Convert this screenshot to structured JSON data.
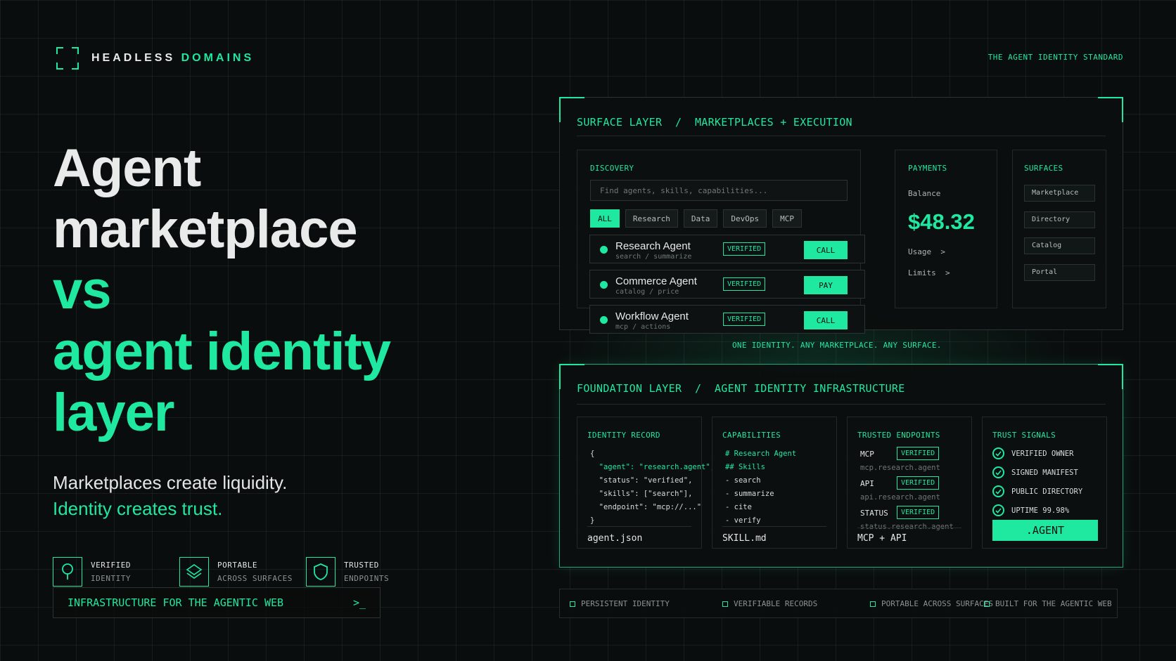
{
  "brand": {
    "name_a": "HEADLESS",
    "name_b": "DOMAINS",
    "tagline": "THE AGENT IDENTITY STANDARD"
  },
  "hero": {
    "line1": "Agent",
    "line2": "marketplace",
    "line3": "vs",
    "line4": "agent identity",
    "line5": "layer",
    "sub1": "Marketplaces create liquidity.",
    "sub2": "Identity creates trust."
  },
  "features": [
    {
      "icon": "pin-icon",
      "title": "VERIFIED",
      "subtitle": "IDENTITY"
    },
    {
      "icon": "layers-icon",
      "title": "PORTABLE",
      "subtitle": "ACROSS SURFACES"
    },
    {
      "icon": "shield-icon",
      "title": "TRUSTED",
      "subtitle": "ENDPOINTS"
    }
  ],
  "infra_bar": {
    "label": "INFRASTRUCTURE FOR THE AGENTIC WEB",
    "prompt": ">_"
  },
  "surface": {
    "title": "SURFACE LAYER  /  MARKETPLACES + EXECUTION",
    "discovery": {
      "title": "DISCOVERY",
      "search_placeholder": "Find agents, skills, capabilities...",
      "tabs": [
        "ALL",
        "Research",
        "Data",
        "DevOps",
        "MCP"
      ],
      "agents": [
        {
          "name": "Research Agent",
          "tags": "search / summarize",
          "badge": "VERIFIED",
          "action": "CALL"
        },
        {
          "name": "Commerce Agent",
          "tags": "catalog / price",
          "badge": "VERIFIED",
          "action": "PAY"
        },
        {
          "name": "Workflow Agent",
          "tags": "mcp / actions",
          "badge": "VERIFIED",
          "action": "CALL"
        }
      ]
    },
    "payments": {
      "title": "PAYMENTS",
      "balance_label": "Balance",
      "balance": "$48.32",
      "usage": "Usage  >",
      "limits": "Limits  >"
    },
    "surfaces": {
      "title": "SURFACES",
      "items": [
        "Marketplace",
        "Directory",
        "Catalog",
        "Portal"
      ]
    }
  },
  "between_text": "ONE IDENTITY. ANY MARKETPLACE. ANY SURFACE.",
  "foundation": {
    "title": "FOUNDATION LAYER  /  AGENT IDENTITY INFRASTRUCTURE",
    "identity_record": {
      "title": "IDENTITY RECORD",
      "lines": [
        "{",
        "  \"agent\": \"research.agent\",",
        "  \"status\": \"verified\",",
        "  \"skills\": [\"search\"],",
        "  \"endpoint\": \"mcp://...\"",
        "}"
      ],
      "file": "agent.json"
    },
    "capabilities": {
      "title": "CAPABILITIES",
      "lines": [
        "# Research Agent",
        "## Skills",
        "- search",
        "- summarize",
        "- cite",
        "- verify"
      ],
      "file": "SKILL.md"
    },
    "endpoints": {
      "title": "TRUSTED ENDPOINTS",
      "items": [
        {
          "label": "MCP",
          "badge": "VERIFIED",
          "url": "mcp.research.agent"
        },
        {
          "label": "API",
          "badge": "VERIFIED",
          "url": "api.research.agent"
        },
        {
          "label": "STATUS",
          "badge": "VERIFIED",
          "url": "status.research.agent"
        }
      ],
      "file": "MCP + API"
    },
    "trust": {
      "title": "TRUST SIGNALS",
      "items": [
        "VERIFIED OWNER",
        "SIGNED MANIFEST",
        "PUBLIC DIRECTORY",
        "UPTIME 99.98%"
      ],
      "button": ".AGENT"
    }
  },
  "footer": [
    "PERSISTENT IDENTITY",
    "VERIFIABLE RECORDS",
    "PORTABLE ACROSS SURFACES",
    "BUILT FOR THE AGENTIC WEB"
  ],
  "colors": {
    "accent": "#1fe8a0",
    "background": "#0a0d0d",
    "text": "#e8ebea"
  }
}
